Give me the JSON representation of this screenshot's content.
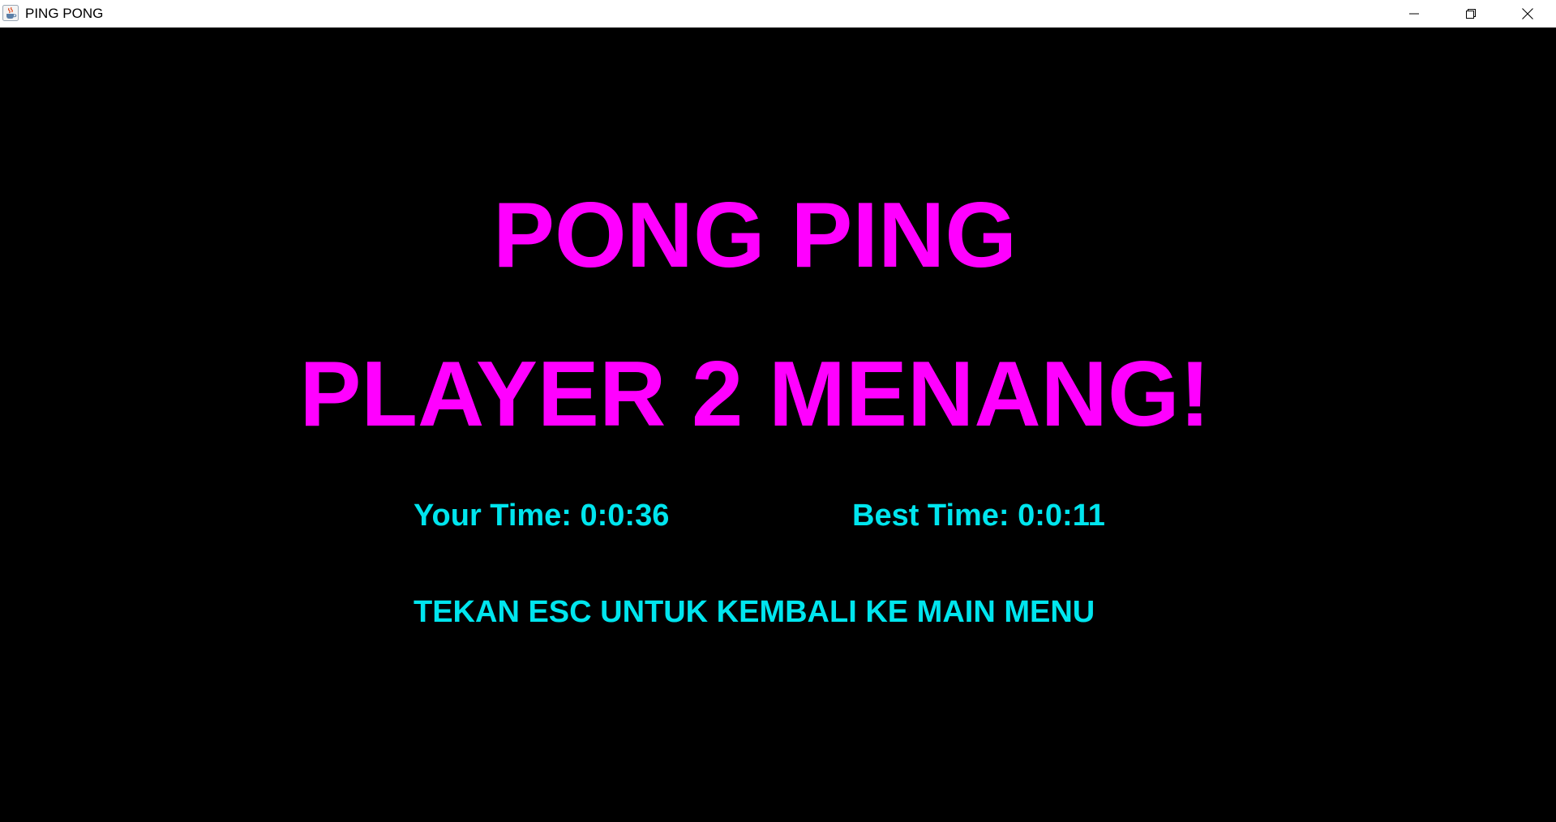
{
  "window": {
    "title": "PING PONG",
    "icon": "java-cup-icon",
    "controls": {
      "minimize_icon": "minimize-icon",
      "restore_icon": "restore-icon",
      "close_icon": "close-icon"
    }
  },
  "screen": {
    "title": "PONG PING",
    "result": "PLAYER 2 MENANG!",
    "your_time": "Your Time: 0:0:36",
    "best_time": "Best Time: 0:0:11",
    "instruction": "TEKAN ESC UNTUK KEMBALI KE MAIN MENU"
  },
  "colors": {
    "background": "#000000",
    "headline": "#ff00ff",
    "info_text": "#00e5ee",
    "titlebar": "#ffffff"
  }
}
